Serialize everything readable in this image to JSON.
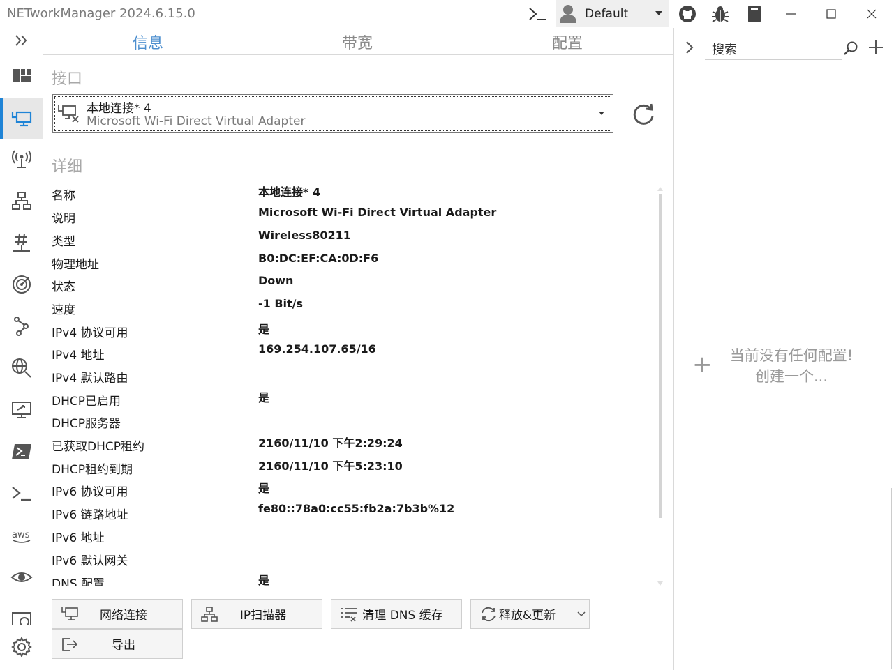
{
  "window": {
    "title": "NETworkManager 2024.6.15.0",
    "profile": "Default"
  },
  "tabs": [
    {
      "label": "信息"
    },
    {
      "label": "带宽"
    },
    {
      "label": "配置"
    }
  ],
  "interface": {
    "section_label": "接口",
    "selected_name": "本地连接* 4",
    "selected_desc": "Microsoft Wi-Fi Direct Virtual Adapter"
  },
  "details": {
    "section_label": "详细",
    "rows": [
      {
        "key": "名称",
        "value": "本地连接* 4"
      },
      {
        "key": "说明",
        "value": "Microsoft Wi-Fi Direct Virtual Adapter"
      },
      {
        "key": "类型",
        "value": "Wireless80211"
      },
      {
        "key": "物理地址",
        "value": "B0:DC:EF:CA:0D:F6"
      },
      {
        "key": "状态",
        "value": "Down"
      },
      {
        "key": "速度",
        "value": "-1 Bit/s"
      },
      {
        "key": "IPv4 协议可用",
        "value": "是"
      },
      {
        "key": "IPv4 地址",
        "value": "169.254.107.65/16"
      },
      {
        "key": "IPv4 默认路由",
        "value": ""
      },
      {
        "key": "DHCP已启用",
        "value": "是"
      },
      {
        "key": "DHCP服务器",
        "value": ""
      },
      {
        "key": "已获取DHCP租约",
        "value": "2160/11/10 下午2:29:24"
      },
      {
        "key": "DHCP租约到期",
        "value": "2160/11/10 下午5:23:10"
      },
      {
        "key": "IPv6 协议可用",
        "value": "是"
      },
      {
        "key": "IPv6 链路地址",
        "value": "fe80::78a0:cc55:fb2a:7b3b%12"
      },
      {
        "key": "IPv6 地址",
        "value": ""
      },
      {
        "key": "IPv6 默认网关",
        "value": ""
      },
      {
        "key": "DNS 配置",
        "value": "是"
      }
    ]
  },
  "buttons": {
    "network_connections": "网络连接",
    "ip_scanner": "IP扫描器",
    "flush_dns": "清理 DNS 缓存",
    "release_renew": "释放&更新",
    "export": "导出"
  },
  "right_panel": {
    "search_placeholder": "搜索",
    "empty_line1": "当前没有任何配置!",
    "empty_line2": "创建一个..."
  },
  "colors": {
    "accent": "#1f84d6",
    "tab_active": "#4d8fcf"
  }
}
